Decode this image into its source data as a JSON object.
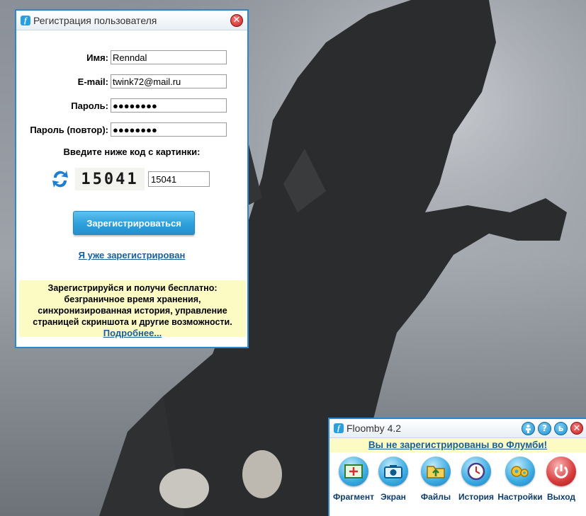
{
  "registration": {
    "title": "Регистрация пользователя",
    "name_label": "Имя:",
    "name_value": "Renndal",
    "email_label": "E-mail:",
    "email_value": "twink72@mail.ru",
    "password_label": "Пароль:",
    "password_value": "●●●●●●●●",
    "password_repeat_label": "Пароль (повтор):",
    "password_repeat_value": "●●●●●●●●",
    "captcha_caption": "Введите ниже код с картинки:",
    "captcha_code": "15041",
    "captcha_input_value": "15041",
    "register_button": "Зарегистрироваться",
    "already_registered_link": "Я уже зарегистрирован",
    "promo_lines": [
      "Зарегистрируйся и получи бесплатно:",
      "безграничное время хранения,",
      "синхронизированная история, управление",
      "страницей скриншота и другие возможности."
    ],
    "promo_more_link": "Подробнее..."
  },
  "floomby": {
    "title": "Floomby 4.2",
    "notice_link": "Вы не зарегистрированы во Флумби!",
    "tools": [
      {
        "label": "Фрагмент",
        "icon": "fragment-icon"
      },
      {
        "label": "Экран",
        "icon": "camera-icon"
      },
      {
        "label": "Файлы",
        "icon": "folder-icon"
      },
      {
        "label": "История",
        "icon": "clock-icon"
      },
      {
        "label": "Настройки",
        "icon": "gears-icon"
      },
      {
        "label": "Выход",
        "icon": "power-icon"
      }
    ]
  },
  "colors": {
    "accent": "#2f86c8",
    "link": "#1a5f9a",
    "promo_bg": "#fdfbc4",
    "close_red": "#c8201f"
  }
}
